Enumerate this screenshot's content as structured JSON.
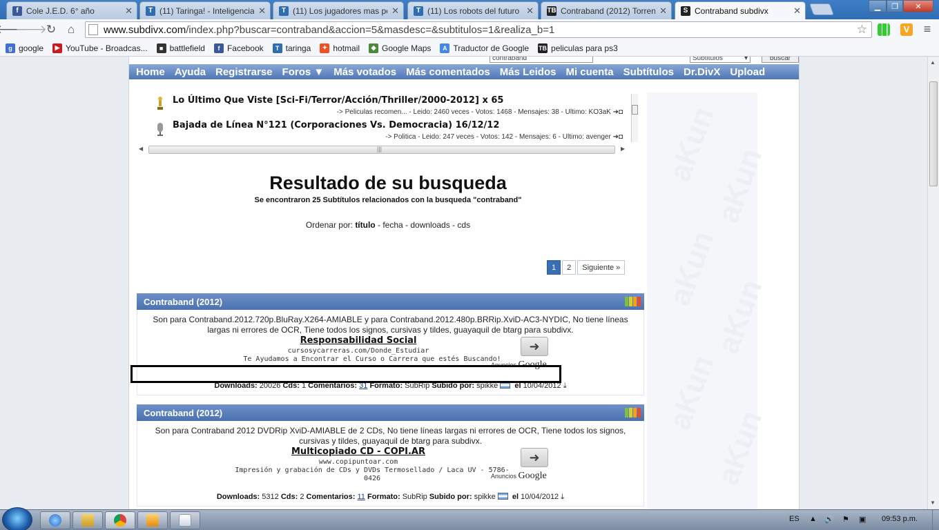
{
  "browser": {
    "tabs": [
      {
        "title": "Cole J.E.D. 6° año",
        "icon": "facebook-icon",
        "color": "#3b5998",
        "glyph": "f"
      },
      {
        "title": "(11) Taringa! - Inteligencia",
        "icon": "taringa-icon",
        "color": "#2f6db3",
        "glyph": "T"
      },
      {
        "title": "(11) Los jugadores mas pe",
        "icon": "taringa-icon",
        "color": "#2f6db3",
        "glyph": "T"
      },
      {
        "title": "(11) Los robots del futuro",
        "icon": "taringa-icon",
        "color": "#2f6db3",
        "glyph": "T"
      },
      {
        "title": "Contraband (2012) Torren",
        "icon": "torrent-icon",
        "color": "#222222",
        "glyph": "TB"
      },
      {
        "title": "Contraband subdivx",
        "icon": "subdivx-icon",
        "color": "#222222",
        "glyph": "S"
      }
    ],
    "url_domain": "www.subdivx.com",
    "url_path": "/index.php?buscar=contraband&accion=5&masdesc=&subtitulos=1&realiza_b=1",
    "bookmarks": [
      {
        "label": "google",
        "icon": "google-icon",
        "color": "#3f6fd8",
        "glyph": "g"
      },
      {
        "label": "YouTube - Broadcas...",
        "icon": "youtube-icon",
        "color": "#cc181e",
        "glyph": "▶"
      },
      {
        "label": "battlefield",
        "icon": "battlefield-icon",
        "color": "#333333",
        "glyph": "■"
      },
      {
        "label": "Facebook",
        "icon": "facebook-icon",
        "color": "#3b5998",
        "glyph": "f"
      },
      {
        "label": "taringa",
        "icon": "taringa-icon",
        "color": "#2f6db3",
        "glyph": "T"
      },
      {
        "label": "hotmail",
        "icon": "hotmail-icon",
        "color": "#f25022",
        "glyph": "✦"
      },
      {
        "label": "Google Maps",
        "icon": "maps-icon",
        "color": "#4a8a3a",
        "glyph": "◆"
      },
      {
        "label": "Traductor de Google",
        "icon": "translate-icon",
        "color": "#4285f4",
        "glyph": "A"
      },
      {
        "label": "peliculas para ps3",
        "icon": "torrent-icon",
        "color": "#222222",
        "glyph": "TB"
      }
    ]
  },
  "site": {
    "search_value": "contraband",
    "search_select": "Subtitulos",
    "search_button": "buscar",
    "nav": [
      "Home",
      "Ayuda",
      "Registrarse",
      "Foros ▼",
      "Más votados",
      "Más comentados",
      "Más Leidos",
      "Mi cuenta",
      "Subtítulos",
      "Dr.DivX",
      "Upload"
    ],
    "news": [
      {
        "title": "Lo Último Que Viste [Sci-Fi/Terror/Acción/Thriller/2000-2012] x 65",
        "meta": "-> Peliculas recomen... - Leido: 2460 veces - Votos: 1468 - Mensajes: 38 - Ultimo: KO3aK"
      },
      {
        "title": "Bajada de Línea N°121 (Corporaciones Vs. Democracia) 16/12/12",
        "meta": "-> Politica - Leido: 247 veces - Votos: 142 - Mensajes: 6 - Ultimo: avenger"
      }
    ],
    "results_title": "Resultado de su busqueda",
    "results_sub": "Se encontraron 25 Subtítulos relacionados con la busqueda \"contraband\"",
    "order": {
      "label": "Ordenar por:",
      "options": [
        "título",
        "fecha",
        "downloads",
        "cds"
      ]
    },
    "pager": {
      "pages": [
        "1",
        "2"
      ],
      "next": "Siguiente »"
    },
    "results": [
      {
        "title": "Contraband (2012)",
        "desc": "Son para Contraband.2012.720p.BluRay.X264-AMIABLE y para Contraband.2012.480p.BRRip.XviD-AC3-NYDIC, No tiene líneas largas ni errores de OCR, Tiene todos los signos, cursivas y tildes, guayaquil de btarg para subdivx.",
        "ad_title": "Responsabilidad Social",
        "ad_url": "cursosycarreras.com/Donde_Estudiar",
        "ad_desc": "Te Ayudamos a Encontrar el Curso o Carrera que estés Buscando!",
        "ads_label": "Anuncios",
        "ads_brand": "Google",
        "downloads": "20026",
        "cds": "1",
        "comments": "31",
        "format": "SubRip",
        "user": "spikke",
        "date": "10/04/2012"
      },
      {
        "title": "Contraband (2012)",
        "desc": "Son para Contraband 2012 DVDRip XviD-AMIABLE de 2 CDs, No tiene líneas largas ni errores de OCR, Tiene todos los signos, cursivas y tildes, guayaquil de btarg para subdivx.",
        "ad_title": "Multicopiado CD - COPI.AR",
        "ad_url": "www.copipuntoar.com",
        "ad_desc": "Impresión y grabación de CDs y DVDs Termosellado / Laca UV - 5786-0426",
        "ads_label": "Anuncios",
        "ads_brand": "Google",
        "downloads": "5312",
        "cds": "2",
        "comments": "11",
        "format": "SubRip",
        "user": "spikke",
        "date": "10/04/2012"
      }
    ],
    "meta_labels": {
      "downloads": "Downloads:",
      "cds": "Cds:",
      "comments": "Comentarios:",
      "format": "Formato:",
      "uploaded": "Subido por:",
      "on": "el"
    },
    "watermark": "aKun"
  },
  "taskbar": {
    "lang": "ES",
    "clock": "09:53 p.m."
  }
}
